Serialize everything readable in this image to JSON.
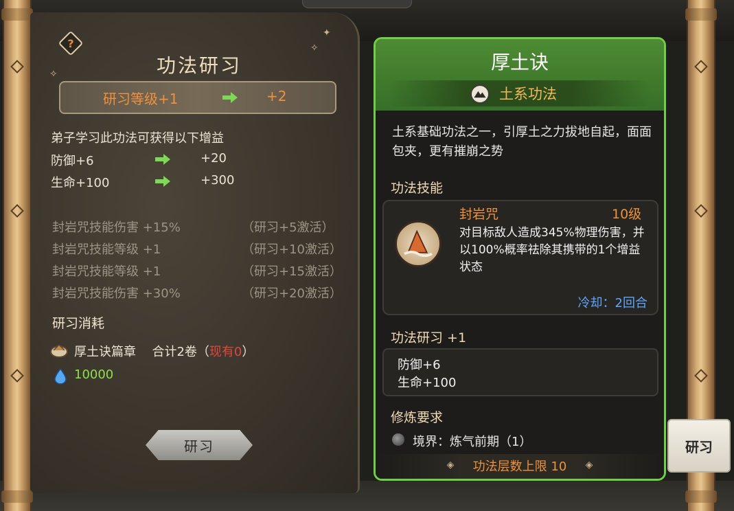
{
  "left_panel": {
    "title": "功法研习",
    "level_from": "研习等级+1",
    "level_to": "+2",
    "gain_intro": "弟子学习此功法可获得以下增益",
    "gains": [
      {
        "label": "防御+6",
        "next": "+20"
      },
      {
        "label": "生命+100",
        "next": "+300"
      }
    ],
    "unlocks": [
      {
        "effect": "封岩咒技能伤害 +15%",
        "condition": "（研习+5激活）"
      },
      {
        "effect": "封岩咒技能等级 +1",
        "condition": "（研习+10激活）"
      },
      {
        "effect": "封岩咒技能等级 +1",
        "condition": "（研习+15激活）"
      },
      {
        "effect": "封岩咒技能伤害 +30%",
        "condition": "（研习+20激活）"
      }
    ],
    "cost_title": "研习消耗",
    "cost_item": "厚土诀篇章",
    "cost_total": "合计2卷（",
    "cost_have": "现有0",
    "cost_close": "）",
    "stone_amount": "10000",
    "study_button": "研习"
  },
  "card": {
    "title": "厚土诀",
    "element": "土系功法",
    "description": "土系基础功法之一，引厚土之力拔地自起，面面包夹，更有摧崩之势",
    "skill_section": "功法技能",
    "skill": {
      "name": "封岩咒",
      "level": "10级",
      "description": "对目标敌人造成345%物理伤害，并以100%概率祛除其携带的1个增益状态",
      "cooldown": "冷却：2回合"
    },
    "study_section": "功法研习 +1",
    "study_bonuses": [
      "防御+6",
      "生命+100"
    ],
    "requirement_section": "修炼要求",
    "requirement": "境界：炼气前期（1）",
    "layer_cap": "功法层数上限 10"
  },
  "side_tab": "研习",
  "colors": {
    "accent_orange": "#f0913d",
    "card_border": "#6fcf46",
    "cooldown_blue": "#5fa6ff",
    "have_red": "#e0463c",
    "stone_green": "#8fe04a"
  }
}
